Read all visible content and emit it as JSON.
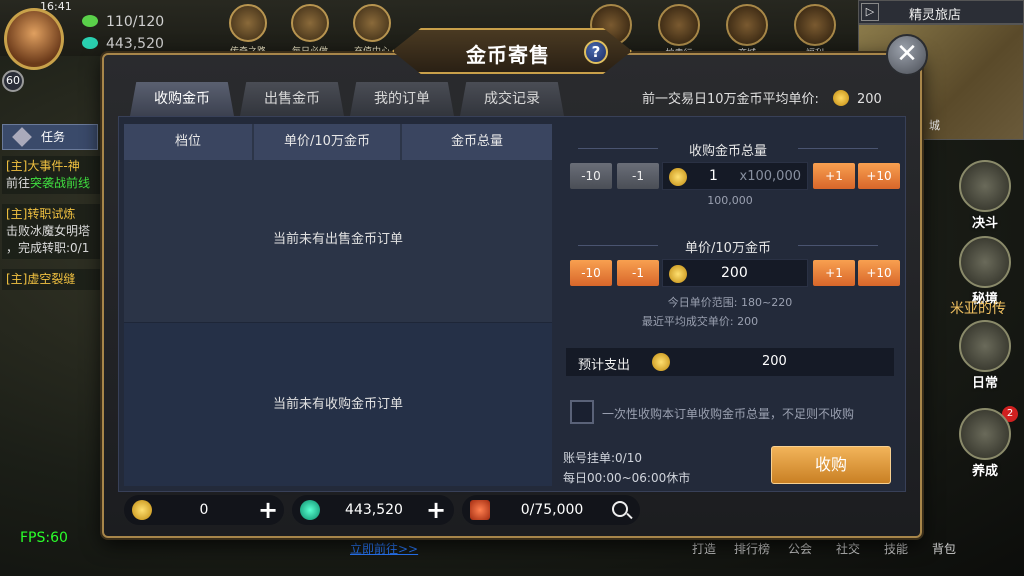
{
  "hud": {
    "clock": "16:41",
    "energy": "110/120",
    "gems": "443,520",
    "level": "60",
    "top_icons": [
      "传奇之路",
      "每日必做",
      "充值中心"
    ],
    "right_icons": [
      "论坛",
      "拍卖行",
      "商城",
      "福利"
    ],
    "inn_title": "精灵旅店",
    "inn_arrow": "▷",
    "map_city": "城",
    "side_buttons": [
      "决斗",
      "秘境",
      "日常",
      "养成"
    ],
    "side_text": "米亚的传",
    "side_badge": "2",
    "quest_tab": "任务",
    "quests": [
      {
        "title": "[主]大事件-神",
        "line1": "前往",
        "line1_green": "突袭战前线"
      },
      {
        "title": "[主]转职试炼",
        "line1": "击败冰魔女明塔",
        "line2": "，完成转职:0/1"
      },
      {
        "title": "[主]虚空裂缝",
        "line1": ""
      }
    ],
    "fps": "FPS:60",
    "link": "立即前往>>",
    "bottom_menu": [
      "打造",
      "排行榜",
      "公会",
      "社交",
      "技能",
      "背包"
    ]
  },
  "modal": {
    "title": "金币寄售",
    "help": "?",
    "close": "✕",
    "tabs": [
      "收购金币",
      "出售金币",
      "我的订单",
      "成交记录"
    ],
    "avg_label": "前一交易日10万金币平均单价:",
    "avg_value": "200",
    "table": {
      "headers": [
        "档位",
        "单价/10万金币",
        "金币总量"
      ],
      "empty_sell": "当前未有出售金币订单",
      "empty_buy": "当前未有收购金币订单"
    },
    "total": {
      "title": "收购金币总量",
      "minus10": "-10",
      "minus1": "-1",
      "plus1": "+1",
      "plus10": "+10",
      "value": "1",
      "multiplier": "x100,000",
      "note": "100,000"
    },
    "price": {
      "title": "单价/10万金币",
      "minus10": "-10",
      "minus1": "-1",
      "plus1": "+1",
      "plus10": "+10",
      "value": "200",
      "range": "今日单价范围: 180~220",
      "recent": "最近平均成交单价: 200"
    },
    "cost": {
      "label": "预计支出",
      "value": "200"
    },
    "checkbox_label": "一次性收购本订单收购金币总量，不足则不收购",
    "account_orders": "账号挂单:0/10",
    "market_hours": "每日00:00~06:00休市",
    "buy_button": "收购"
  },
  "currency": {
    "gold": "0",
    "gems": "443,520",
    "scroll": "0/75,000",
    "plus": "+"
  },
  "colors": {
    "accent_orange": "#e8783a",
    "frame_gold": "#a8864a",
    "panel_blue": "#2c3548"
  }
}
